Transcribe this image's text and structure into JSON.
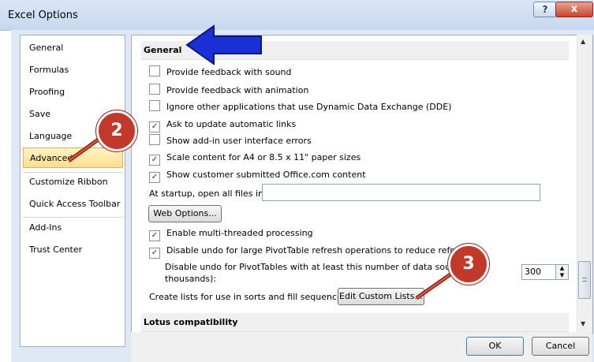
{
  "window": {
    "title": "Excel Options",
    "help_label": "?",
    "close_label": "x"
  },
  "sidebar": {
    "items": [
      {
        "label": "General"
      },
      {
        "label": "Formulas"
      },
      {
        "label": "Proofing"
      },
      {
        "label": "Save"
      },
      {
        "label": "Language"
      },
      {
        "label": "Advanced",
        "selected": true
      },
      {
        "label": "Customize Ribbon"
      },
      {
        "label": "Quick Access Toolbar"
      },
      {
        "label": "Add-Ins"
      },
      {
        "label": "Trust Center"
      }
    ]
  },
  "content": {
    "general_header": "General",
    "options": [
      {
        "label": "Provide feedback with sound",
        "checked": false
      },
      {
        "label": "Provide feedback with animation",
        "checked": false
      },
      {
        "label": "Ignore other applications that use Dynamic Data Exchange (DDE)",
        "checked": false
      },
      {
        "label": "Ask to update automatic links",
        "checked": true
      },
      {
        "label": "Show add-in user interface errors",
        "checked": false
      },
      {
        "label": "Scale content for A4 or 8.5 x 11\" paper sizes",
        "checked": true
      },
      {
        "label": "Show customer submitted Office.com content",
        "checked": true
      }
    ],
    "startup_label": "At startup, open all files in:",
    "startup_value": "",
    "web_options_label": "Web Options...",
    "multithread_label": "Enable multi-threaded processing",
    "multithread_checked": true,
    "undo_pivot_label": "Disable undo for large PivotTable refresh operations to reduce refresh t",
    "undo_pivot_checked": true,
    "undo_rows_label_1": "Disable undo for PivotTables with at least this number of data source ro",
    "undo_rows_label_2": "thousands):",
    "undo_rows_value": "300",
    "custom_lists_label": "Create lists for use in sorts and fill sequences:",
    "edit_custom_lists_label": "Edit Custom Lists...",
    "lotus_header": "Lotus compatibility"
  },
  "footer": {
    "ok_label": "OK",
    "cancel_label": "Cancel"
  },
  "callouts": {
    "two": "2",
    "three": "3"
  },
  "colors": {
    "callout": "#c0392b",
    "arrow": "#1a2fd6",
    "selected": "#ffe08a"
  }
}
